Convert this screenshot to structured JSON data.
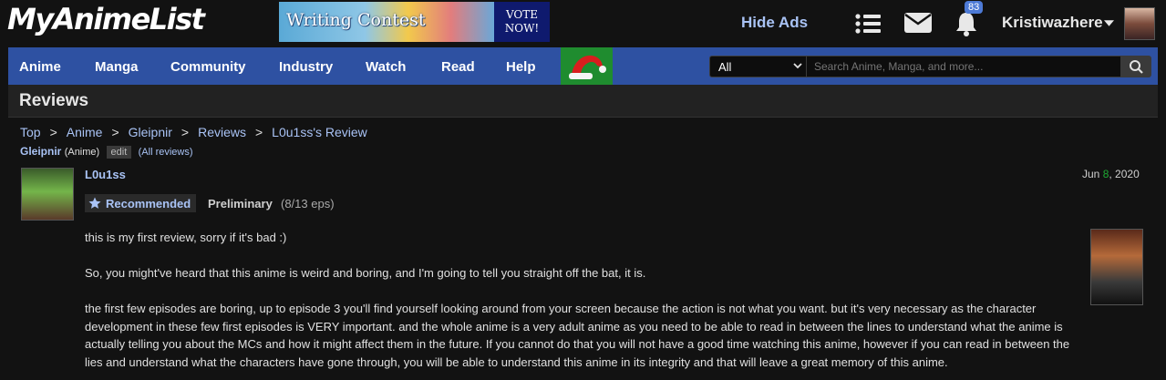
{
  "header": {
    "logo_text": "MyAnimeList",
    "banner_left": "Writing Contest",
    "banner_right": "VOTE\nNOW!",
    "hide_ads": "Hide Ads",
    "notification_count": "83",
    "username": "Kristiwazhere",
    "icons": [
      "list-icon",
      "mail-icon",
      "bell-icon",
      "caret-down-icon"
    ]
  },
  "nav": {
    "items": [
      "Anime",
      "Manga",
      "Community",
      "Industry",
      "Watch",
      "Read",
      "Help"
    ],
    "search_select": "All",
    "search_placeholder": "Search Anime, Manga, and more...",
    "icons": [
      "santa-hat-icon",
      "search-icon"
    ]
  },
  "page": {
    "title": "Reviews",
    "breadcrumb": [
      "Top",
      "Anime",
      "Gleipnir",
      "Reviews",
      "L0u1ss's Review"
    ],
    "anime_name": "Gleipnir",
    "anime_type": "(Anime)",
    "edit_label": "edit",
    "all_reviews": "(All reviews)"
  },
  "review": {
    "reviewer": "L0u1ss",
    "date_prefix": "Jun ",
    "date_day": "8",
    "date_suffix": ", 2020",
    "tag": "Recommended",
    "status": "Preliminary",
    "episodes": "(8/13 eps)",
    "paragraphs": [
      "this is my first review, sorry if it's bad :)",
      "So, you might've heard that this anime is weird and boring, and I'm going to tell you straight off the bat, it is.",
      "the first few episodes are boring, up to episode 3 you'll find yourself looking around from your screen because the action is not what you want. but it's very necessary as the character development in these few first episodes is VERY important. and the whole anime is a very adult anime as you need to be able to read in between the lines to understand what the anime is actually telling you about the MCs and how it might affect them in the future. If you cannot do that you will not have a good time watching this anime, however if you can read in between the lies and understand what the characters have gone through, you will be able to understand this anime in its integrity and that will leave a great memory of this anime."
    ]
  },
  "colors": {
    "nav_bg": "#2e51a2",
    "link": "#a9c3f5",
    "page_bg": "#121212",
    "date_highlight": "#1ea832",
    "santa_bg": "#1f8c2f"
  }
}
